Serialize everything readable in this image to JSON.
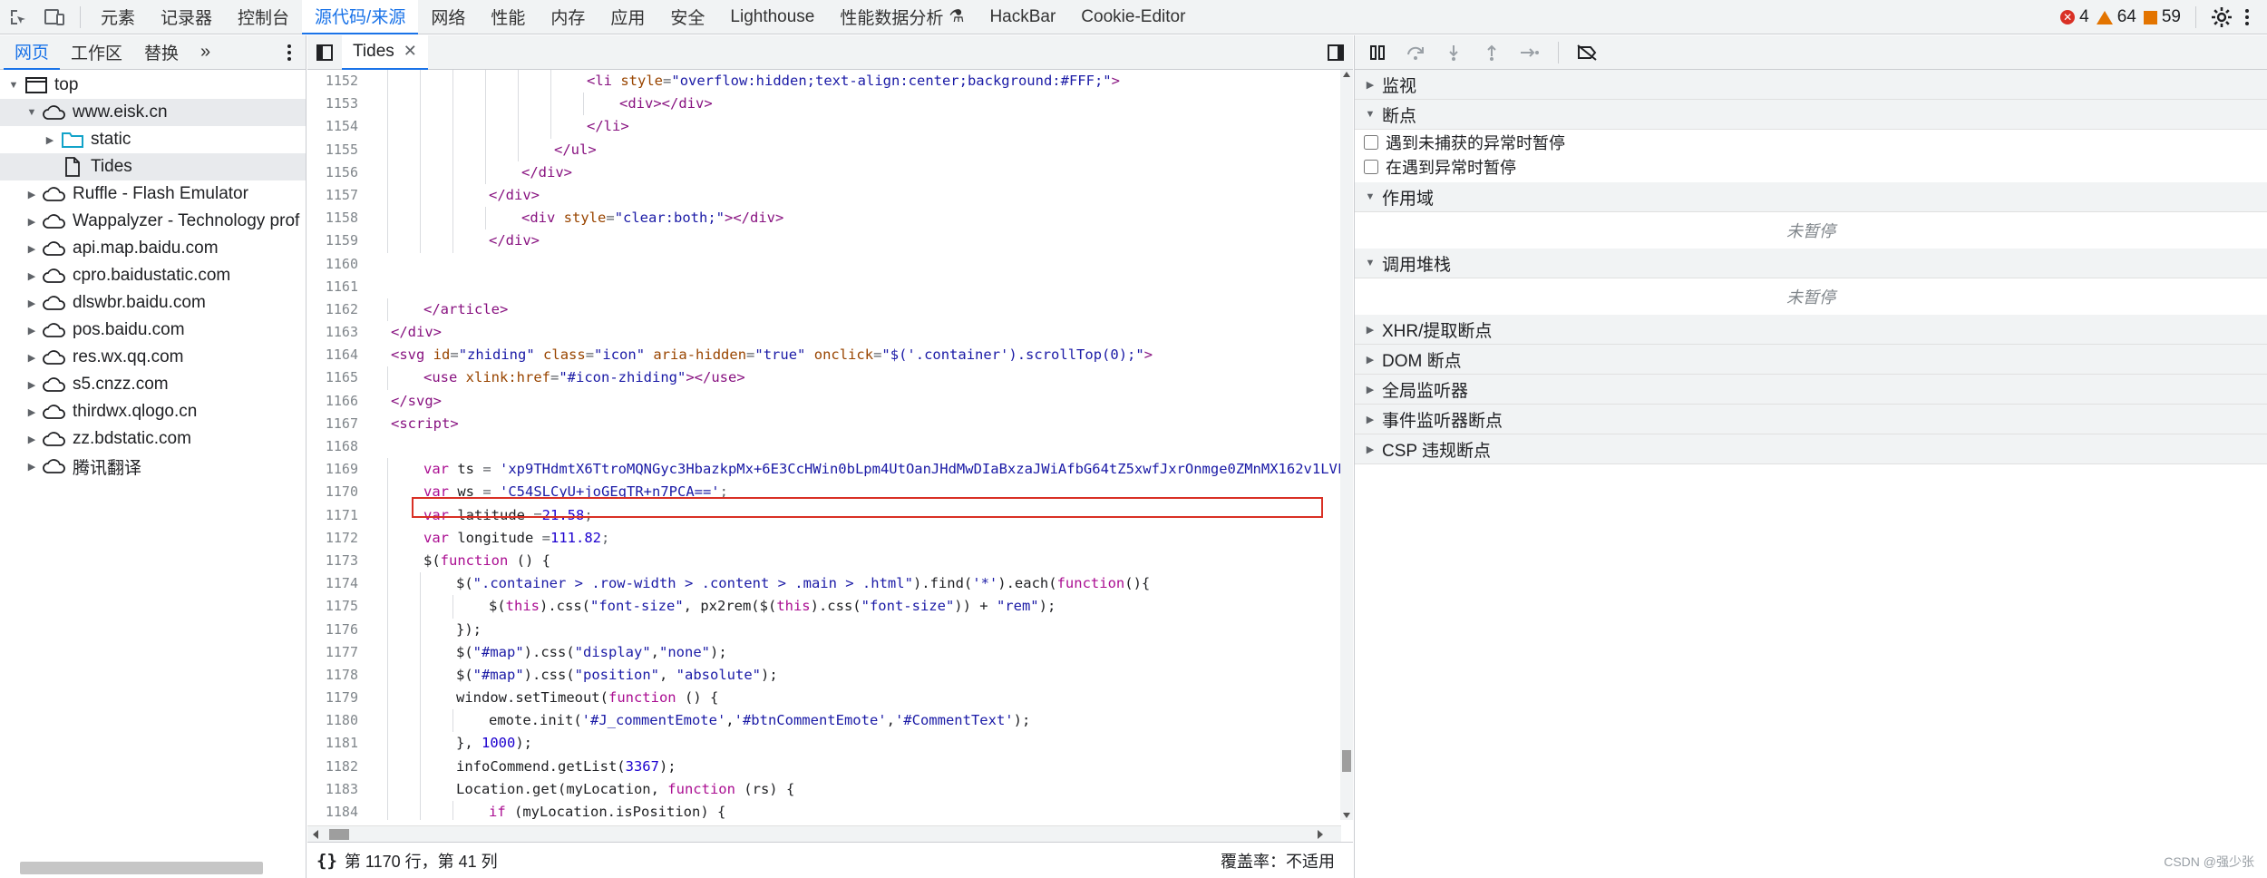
{
  "topbar": {
    "tabs": [
      "元素",
      "记录器",
      "控制台",
      "源代码/来源",
      "网络",
      "性能",
      "内存",
      "应用",
      "安全",
      "Lighthouse",
      "性能数据分析",
      "HackBar",
      "Cookie-Editor"
    ],
    "errors": "4",
    "warnings": "64",
    "issues": "59"
  },
  "left": {
    "tabs": [
      "网页",
      "工作区",
      "替换"
    ],
    "tree": [
      {
        "label": "top",
        "level": 0,
        "icon": "frame-icon",
        "expanded": true
      },
      {
        "label": "www.eisk.cn",
        "level": 1,
        "icon": "cloud-icon",
        "expanded": true,
        "selected": true
      },
      {
        "label": "static",
        "level": 2,
        "icon": "folder-icon",
        "expanded": false
      },
      {
        "label": "Tides",
        "level": 2,
        "icon": "file-icon",
        "selected": true
      },
      {
        "label": "Ruffle - Flash Emulator",
        "level": 1,
        "icon": "cloud-icon"
      },
      {
        "label": "Wappalyzer - Technology prof",
        "level": 1,
        "icon": "cloud-icon"
      },
      {
        "label": "api.map.baidu.com",
        "level": 1,
        "icon": "cloud-icon"
      },
      {
        "label": "cpro.baidustatic.com",
        "level": 1,
        "icon": "cloud-icon"
      },
      {
        "label": "dlswbr.baidu.com",
        "level": 1,
        "icon": "cloud-icon"
      },
      {
        "label": "pos.baidu.com",
        "level": 1,
        "icon": "cloud-icon"
      },
      {
        "label": "res.wx.qq.com",
        "level": 1,
        "icon": "cloud-icon"
      },
      {
        "label": "s5.cnzz.com",
        "level": 1,
        "icon": "cloud-icon"
      },
      {
        "label": "thirdwx.qlogo.cn",
        "level": 1,
        "icon": "cloud-icon"
      },
      {
        "label": "zz.bdstatic.com",
        "level": 1,
        "icon": "cloud-icon"
      },
      {
        "label": "腾讯翻译",
        "level": 1,
        "icon": "cloud-icon"
      }
    ]
  },
  "editor": {
    "tab_label": "Tides",
    "status_position": "第 1170 行，第 41 列",
    "coverage": "覆盖率：不适用",
    "lines": [
      {
        "n": "1152",
        "indent": 6,
        "html": "<span class=\"tag\">&lt;li</span> <span class=\"attr\">style</span>=<span class=\"str\">\"overflow:hidden;text-align:center;background:#FFF;\"</span><span class=\"tag\">&gt;</span>"
      },
      {
        "n": "1153",
        "indent": 7,
        "html": "<span class=\"tag\">&lt;div&gt;&lt;/div&gt;</span>"
      },
      {
        "n": "1154",
        "indent": 6,
        "html": "<span class=\"tag\">&lt;/li&gt;</span>"
      },
      {
        "n": "1155",
        "indent": 5,
        "html": "<span class=\"tag\">&lt;/ul&gt;</span>"
      },
      {
        "n": "1156",
        "indent": 4,
        "html": "<span class=\"tag\">&lt;/div&gt;</span>"
      },
      {
        "n": "1157",
        "indent": 3,
        "html": "<span class=\"tag\">&lt;/div&gt;</span>"
      },
      {
        "n": "1158",
        "indent": 4,
        "html": "<span class=\"tag\">&lt;div</span> <span class=\"attr\">style</span>=<span class=\"str\">\"clear:both;\"</span><span class=\"tag\">&gt;&lt;/div&gt;</span>"
      },
      {
        "n": "1159",
        "indent": 3,
        "html": "<span class=\"tag\">&lt;/div&gt;</span>"
      },
      {
        "n": "1160",
        "indent": 0,
        "html": ""
      },
      {
        "n": "1161",
        "indent": 0,
        "html": ""
      },
      {
        "n": "1162",
        "indent": 1,
        "html": "<span class=\"tag\">&lt;/article&gt;</span>"
      },
      {
        "n": "1163",
        "indent": 0,
        "html": "<span class=\"tag\">&lt;/div&gt;</span>"
      },
      {
        "n": "1164",
        "indent": 0,
        "html": "<span class=\"tag\">&lt;svg</span> <span class=\"attr\">id</span>=<span class=\"str\">\"zhiding\"</span> <span class=\"attr\">class</span>=<span class=\"str\">\"icon\"</span> <span class=\"attr\">aria-hidden</span>=<span class=\"str\">\"true\"</span> <span class=\"attr\">onclick</span>=<span class=\"str\">\"$('.container').scrollTop(0);\"</span><span class=\"tag\">&gt;</span>"
      },
      {
        "n": "1165",
        "indent": 1,
        "html": "<span class=\"tag\">&lt;use</span> <span class=\"attr\">xlink:href</span>=<span class=\"str\">\"#icon-zhiding\"</span><span class=\"tag\">&gt;&lt;/use&gt;</span>"
      },
      {
        "n": "1166",
        "indent": 0,
        "html": "<span class=\"tag\">&lt;/svg&gt;</span>"
      },
      {
        "n": "1167",
        "indent": 0,
        "html": "<span class=\"tag\">&lt;script&gt;</span>"
      },
      {
        "n": "1168",
        "indent": 0,
        "html": ""
      },
      {
        "n": "1169",
        "indent": 1,
        "html": "<span class=\"kw\">var</span> <span class=\"fn\">ts</span> = <span class=\"str\">'xp9THdmtX6TtroMQNGyc3HbazkpMx+6E3CcHWin0bLpm4UtOanJHdMwDIaBxzaJWiAfbG64tZ5xwfJxrOnmge0ZMnMX162v1LVF0</span>"
      },
      {
        "n": "1170",
        "indent": 1,
        "html": "<span class=\"kw\">var</span> <span class=\"fn\">ws</span> = <span class=\"str\">'C54SLCyU+joGEqTR+n7PCA=='</span>;"
      },
      {
        "n": "1171",
        "indent": 1,
        "html": "<span class=\"kw\">var</span> <span class=\"fn\">latitude</span> =<span class=\"num\">21.58</span>;"
      },
      {
        "n": "1172",
        "indent": 1,
        "html": "<span class=\"kw\">var</span> <span class=\"fn\">longitude</span> =<span class=\"num\">111.82</span>;"
      },
      {
        "n": "1173",
        "indent": 1,
        "html": "<span class=\"fn\">$(</span><span class=\"kw\">function</span> <span class=\"fn\">() {</span>"
      },
      {
        "n": "1174",
        "indent": 2,
        "html": "<span class=\"fn\">$(</span><span class=\"str\">\".container &gt; .row-width &gt; .content &gt; .main &gt; .html\"</span><span class=\"fn\">).find(</span><span class=\"str\">'*'</span><span class=\"fn\">).each(</span><span class=\"kw\">function</span><span class=\"fn\">(){</span>"
      },
      {
        "n": "1175",
        "indent": 3,
        "html": "<span class=\"fn\">$(</span><span class=\"kw\">this</span><span class=\"fn\">).css(</span><span class=\"str\">\"font-size\"</span><span class=\"fn\">, px2rem($(</span><span class=\"kw\">this</span><span class=\"fn\">).css(</span><span class=\"str\">\"font-size\"</span><span class=\"fn\">)) + </span><span class=\"str\">\"rem\"</span><span class=\"fn\">);</span>"
      },
      {
        "n": "1176",
        "indent": 2,
        "html": "<span class=\"fn\">});</span>"
      },
      {
        "n": "1177",
        "indent": 2,
        "html": "<span class=\"fn\">$(</span><span class=\"str\">\"#map\"</span><span class=\"fn\">).css(</span><span class=\"str\">\"display\"</span><span class=\"fn\">,</span><span class=\"str\">\"none\"</span><span class=\"fn\">);</span>"
      },
      {
        "n": "1178",
        "indent": 2,
        "html": "<span class=\"fn\">$(</span><span class=\"str\">\"#map\"</span><span class=\"fn\">).css(</span><span class=\"str\">\"position\"</span><span class=\"fn\">, </span><span class=\"str\">\"absolute\"</span><span class=\"fn\">);</span>"
      },
      {
        "n": "1179",
        "indent": 2,
        "html": "<span class=\"fn\">window.setTimeout(</span><span class=\"kw\">function</span> <span class=\"fn\">() {</span>"
      },
      {
        "n": "1180",
        "indent": 3,
        "html": "<span class=\"fn\">emote.init(</span><span class=\"str\">'#J_commentEmote'</span><span class=\"fn\">,</span><span class=\"str\">'#btnCommentEmote'</span><span class=\"fn\">,</span><span class=\"str\">'#CommentText'</span><span class=\"fn\">);</span>"
      },
      {
        "n": "1181",
        "indent": 2,
        "html": "<span class=\"fn\">}, </span><span class=\"num\">1000</span><span class=\"fn\">);</span>"
      },
      {
        "n": "1182",
        "indent": 2,
        "html": "<span class=\"fn\">infoCommend.getList(</span><span class=\"num\">3367</span><span class=\"fn\">);</span>"
      },
      {
        "n": "1183",
        "indent": 2,
        "html": "<span class=\"fn\">Location.get(myLocation, </span><span class=\"kw\">function</span> <span class=\"fn\">(rs) {</span>"
      },
      {
        "n": "1184",
        "indent": 3,
        "html": "<span class=\"kw\">if</span> <span class=\"fn\">(myLocation.isPosition) {</span>"
      }
    ]
  },
  "right": {
    "sections": {
      "watch": "监视",
      "breakpoints": "断点",
      "pause_uncaught": "遇到未捕获的异常时暂停",
      "pause_caught": "在遇到异常时暂停",
      "scope": "作用域",
      "not_paused": "未暂停",
      "call_stack": "调用堆栈",
      "not_paused_2": "未暂停",
      "xhr": "XHR/提取断点",
      "dom": "DOM 断点",
      "global": "全局监听器",
      "event": "事件监听器断点",
      "csp": "CSP 违规断点"
    }
  },
  "watermark": "CSDN @强少张"
}
